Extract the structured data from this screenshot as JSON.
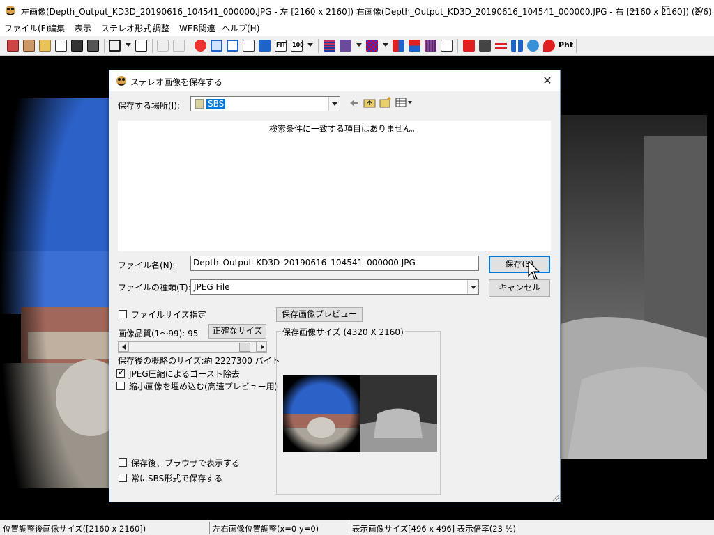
{
  "window": {
    "title": "左画像(Depth_Output_KD3D_20190616_104541_000000.JPG - 左 [2160 x 2160]) 右画像(Depth_Output_KD3D_20190616_104541_000000.JPG - 右 [2160 x 2160])  (2/6)",
    "minimize": "—",
    "maximize": "☐",
    "close": "✕"
  },
  "menu": {
    "items": [
      "ファイル(F)",
      "編集",
      "表示",
      "ステレオ形式",
      "調整",
      "WEB関連",
      "ヘルプ(H)"
    ]
  },
  "toolbar": {
    "fit_label": "FIT",
    "zoom100_label": "100",
    "pht_label": "Pht",
    "accent_blue": "#1e64c8",
    "accent_red": "#e02020"
  },
  "status": {
    "seg1": "位置調整後画像サイズ([2160 x 2160])",
    "seg2": "左右画像位置調整(x=0 y=0)",
    "seg3": "表示画像サイズ[496 x 496]  表示倍率(23 %)"
  },
  "dialog": {
    "title": "ステレオ画像を保存する",
    "close": "✕",
    "save_in_label": "保存する場所(I):",
    "save_in_value": "SBS",
    "empty_message": "検索条件に一致する項目はありません。",
    "filename_label": "ファイル名(N):",
    "filename_value": "Depth_Output_KD3D_20190616_104541_000000.JPG",
    "filetype_label": "ファイルの種類(T):",
    "filetype_value": "JPEG File",
    "save_button": "保存(S)",
    "cancel_button": "キャンセル",
    "filesize_check_label": "ファイルサイズ指定",
    "filesize_checked": false,
    "quality_label": "画像品質(1～99):  95",
    "precise_size_button": "正確なサイズ",
    "quality_value": 95,
    "approx_size_label": "保存後の概略のサイズ:約  2227300 バイト",
    "ghost_removal_label": "JPEG圧縮によるゴースト除去",
    "ghost_removal_checked": true,
    "embed_thumbnail_label": "縮小画像を埋め込む(高速プレビュー用)",
    "embed_thumbnail_checked": false,
    "preview_button": "保存画像プレビュー",
    "preview_group_label": "保存画像サイズ (4320 X 2160)",
    "open_browser_label": "保存後、ブラウザで表示する",
    "open_browser_checked": false,
    "always_sbs_label": "常にSBS形式で保存する",
    "always_sbs_checked": false
  }
}
